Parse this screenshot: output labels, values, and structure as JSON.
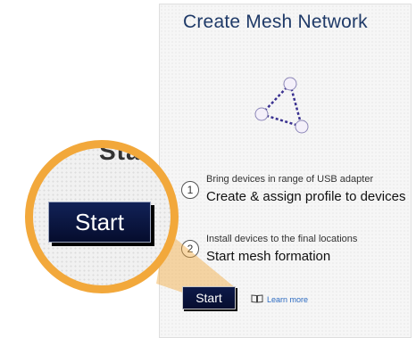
{
  "dialog": {
    "title": "Create Mesh Network"
  },
  "steps": [
    {
      "number": "1",
      "caption": "Bring devices in range of USB adapter",
      "label": "Create & assign profile to devices"
    },
    {
      "number": "2",
      "caption": "Install devices to the final locations",
      "label": "Start mesh formation"
    }
  ],
  "actions": {
    "start_label": "Start",
    "learn_more": "Learn more"
  },
  "magnifier": {
    "start_label": "Start",
    "partial_text": "Sta"
  },
  "colors": {
    "title": "#1f3a68",
    "button": "#0d1a4a",
    "highlight": "#f2a83b",
    "link": "#2e6cc2",
    "diagram_line": "#3a3190"
  },
  "icons": {
    "diagram": "mesh-triangle-icon",
    "learn_more": "book-icon"
  }
}
